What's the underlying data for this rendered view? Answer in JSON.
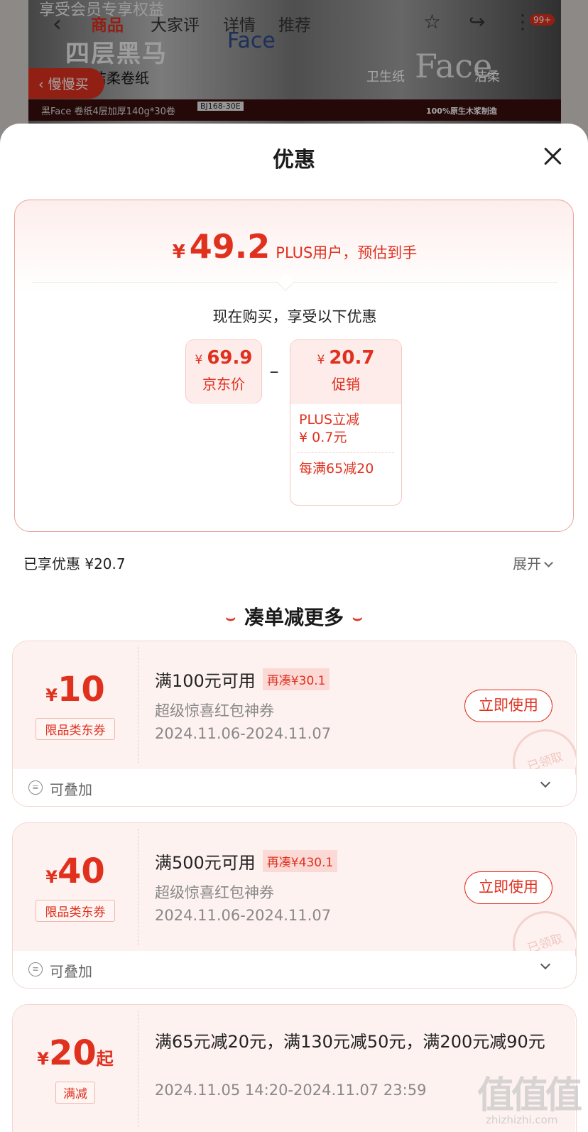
{
  "background": {
    "nav": {
      "tabs": [
        "商品",
        "大家评",
        "详情",
        "推荐"
      ],
      "cart_badge": "99+"
    },
    "banner_promo": "享受会员专享权益",
    "product_big_text": "四层黑马",
    "product_sub_text": "洁柔卷纸",
    "product_label_1": "卫生纸",
    "product_label_2": "洁柔",
    "face_text": "Face",
    "product_strip": "黑Face 卷纸4层加厚140g*30卷",
    "product_code": "BJ168-30E",
    "product_slogan": "100%原生木浆制造",
    "slow_buy": "慢慢买"
  },
  "sheet": {
    "title": "优惠",
    "price": {
      "yen": "¥",
      "value": "49.2",
      "desc": "PLUS用户，预估到手"
    },
    "buy_now_text": "现在购买，享受以下优惠",
    "jd_price": {
      "yen": "¥",
      "value": "69.9",
      "label": "京东价"
    },
    "minus": "–",
    "promotion": {
      "yen": "¥",
      "value": "20.7",
      "label": "促销",
      "items": [
        "PLUS立减\n¥ 0.7元",
        "每满65减20"
      ]
    },
    "enjoyed": "已享优惠 ¥20.7",
    "expand": "展开",
    "more_title": "凑单减更多",
    "coupons": [
      {
        "yen": "¥",
        "amount": "10",
        "tag": "限品类东券",
        "condition": "满100元可用",
        "again": "再凑¥30.1",
        "name": "超级惊喜红包神券",
        "dates": "2024.11.06-2024.11.07",
        "use_button": "立即使用",
        "stamp": "已领取",
        "stackable": "可叠加"
      },
      {
        "yen": "¥",
        "amount": "40",
        "tag": "限品类东券",
        "condition": "满500元可用",
        "again": "再凑¥430.1",
        "name": "超级惊喜红包神券",
        "dates": "2024.11.06-2024.11.07",
        "use_button": "立即使用",
        "stamp": "已领取",
        "stackable": "可叠加"
      },
      {
        "yen": "¥",
        "amount": "20",
        "suffix": "起",
        "tag": "满减",
        "condition": "满65元减20元，满130元减50元，满200元减90元",
        "dates": "2024.11.05 14:20-2024.11.07 23:59"
      }
    ]
  },
  "watermark": {
    "main": "值值值",
    "sub": "zhizhizhi.com"
  },
  "colors": {
    "accent": "#e0301e",
    "coupon_bg": "#fdf2f0",
    "tag_bg": "#fbd9d5"
  }
}
